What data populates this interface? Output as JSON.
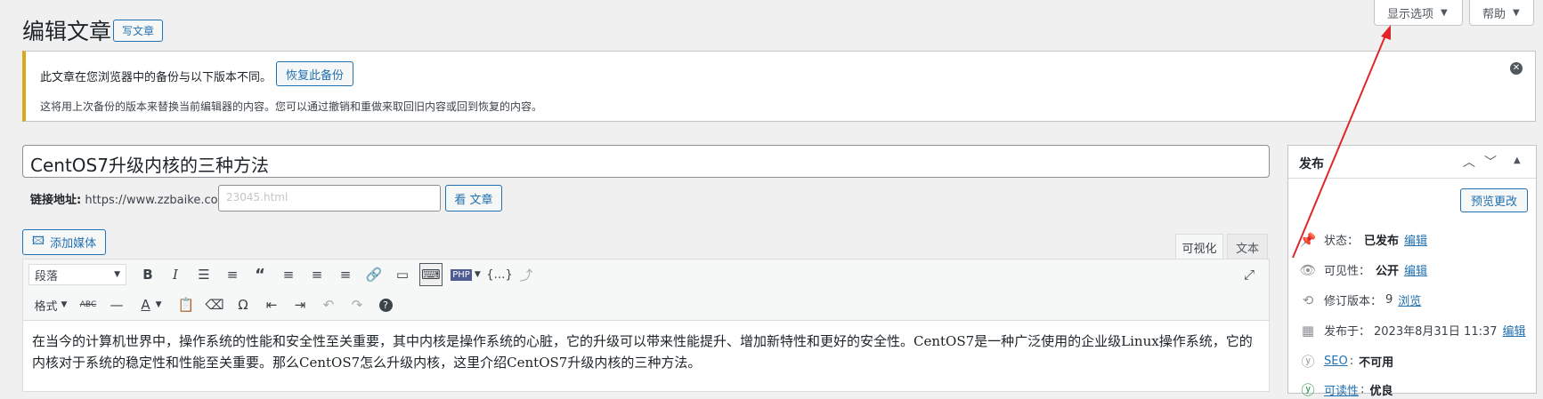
{
  "header": {
    "title": "编辑文章",
    "new_post": "写文章",
    "screen_options": "显示选项",
    "help": "帮助"
  },
  "notice": {
    "line1": "此文章在您浏览器中的备份与以下版本不同。",
    "restore_button": "恢复此备份",
    "line2": "这将用上次备份的版本来替换当前编辑器的内容。您可以通过撤销和重做来取回旧内容或回到恢复的内容。"
  },
  "post": {
    "title": "CentOS7升级内核的三种方法",
    "permalink_label": "链接地址:",
    "permalink_base": "https://www.zzbaike.com/",
    "slug_placeholder": "23045.html",
    "view_button": "看 文章"
  },
  "editor": {
    "add_media": "添加媒体",
    "tab_visual": "可视化",
    "tab_text": "文本",
    "format_select": "段落",
    "format_menu": "格式",
    "content": "在当今的计算机世界中，操作系统的性能和安全性至关重要，其中内核是操作系统的心脏，它的升级可以带来性能提升、增加新特性和更好的安全性。CentOS7是一种广泛使用的企业级Linux操作系统，它的内核对于系统的稳定性和性能至关重要。那么CentOS7怎么升级内核，这里介绍CentOS7升级内核的三种方法。"
  },
  "publish": {
    "heading": "发布",
    "preview": "预览更改",
    "status_label": "状态：",
    "status_value": "已发布",
    "visibility_label": "可见性：",
    "visibility_value": "公开",
    "revisions_label": "修订版本：",
    "revisions_value": "9",
    "browse": "浏览",
    "published_label": "发布于：",
    "published_value": "2023年8月31日 11:37",
    "edit": "编辑",
    "seo_label": "SEO",
    "seo_value": "不可用",
    "readability_label": "可读性",
    "readability_value": "优良"
  },
  "colors": {
    "accent": "#2271b1",
    "warning": "#dba617",
    "annotation_arrow": "#e0262a"
  }
}
